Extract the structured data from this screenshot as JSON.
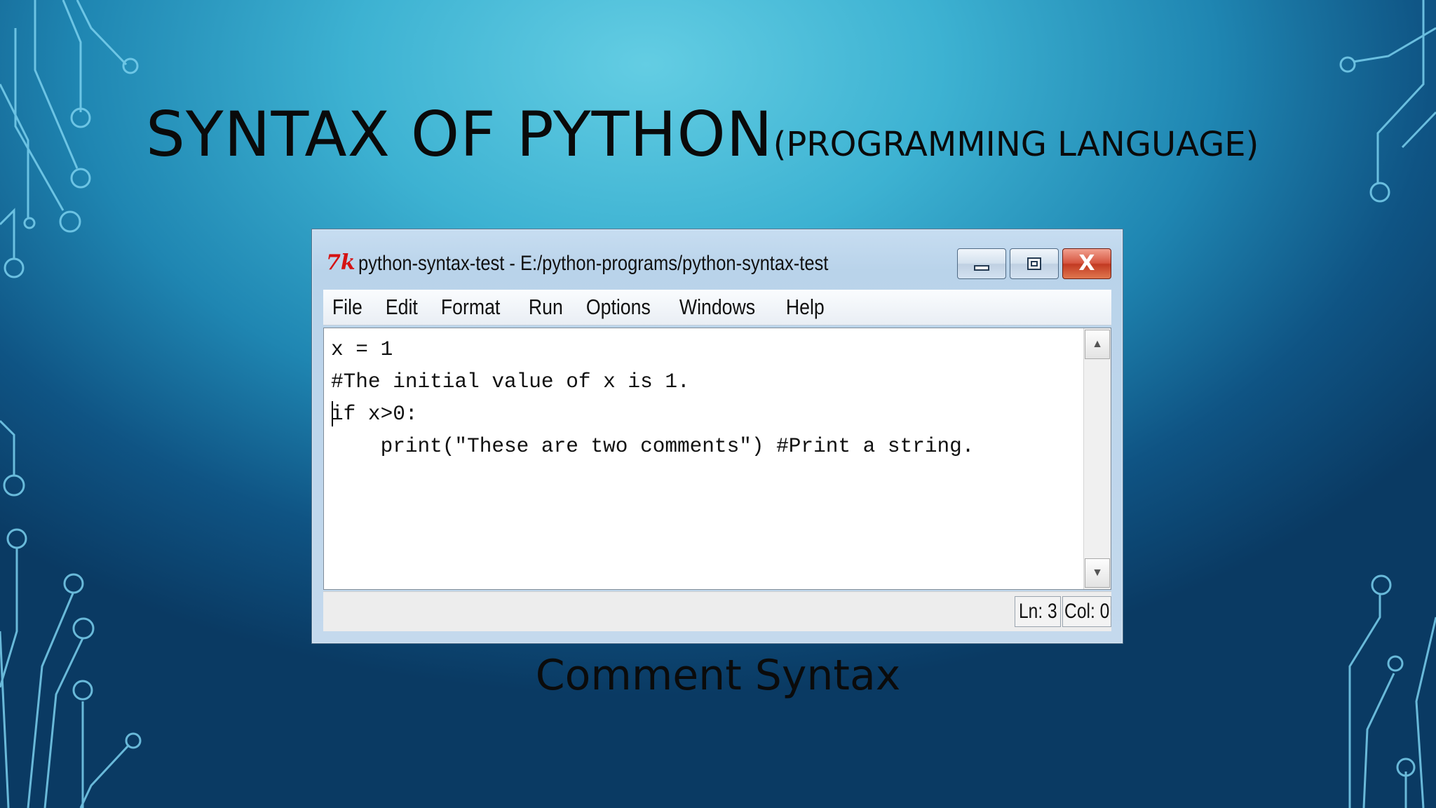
{
  "slide": {
    "title_main": "SYNTAX OF PYTHON",
    "title_sub": "(PROGRAMMING LANGUAGE)",
    "caption": "Comment Syntax"
  },
  "window": {
    "app_icon": "tk-icon",
    "title": "python-syntax-test - E:/python-programs/python-syntax-test",
    "controls": {
      "minimize_icon": "minimize-icon",
      "maximize_icon": "maximize-icon",
      "close_icon": "close-icon",
      "close_glyph": "X",
      "close_color": "#c9412a"
    }
  },
  "menu": [
    "File",
    "Edit",
    "Format",
    "Run",
    "Options",
    "Windows",
    "Help"
  ],
  "editor": {
    "lines": [
      "x = 1",
      "#The initial value of x is 1.",
      "if x>0:",
      "    print(\"These are two comments\") #Print a string."
    ],
    "cursor": {
      "line": 3,
      "col": 0
    }
  },
  "scrollbar": {
    "up_icon": "scroll-up-arrow-icon",
    "down_icon": "scroll-down-arrow-icon"
  },
  "status": {
    "ln": "Ln: 3",
    "col": "Col: 0"
  }
}
